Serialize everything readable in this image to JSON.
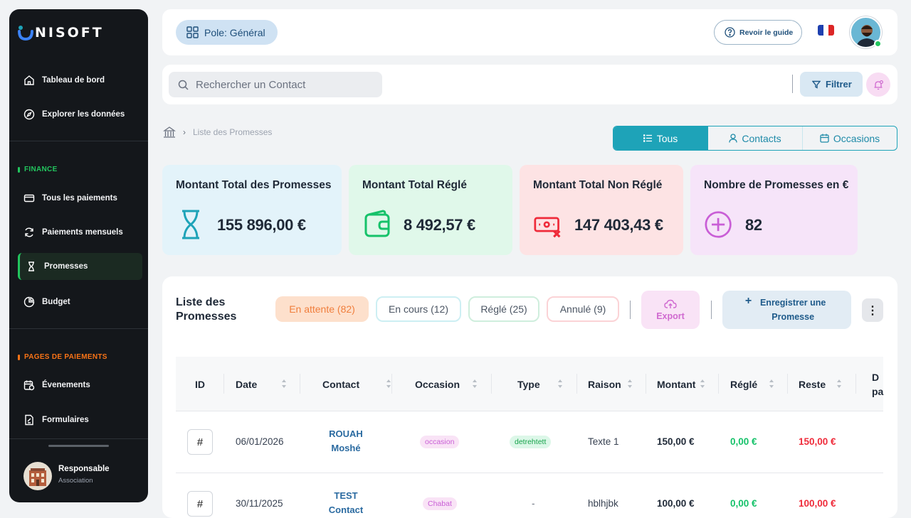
{
  "brand": {
    "name": "NISOFT"
  },
  "sidebar": {
    "items": [
      {
        "label": "Tableau de bord"
      },
      {
        "label": "Explorer les données"
      }
    ],
    "finance_label": "FINANCE",
    "finance_items": [
      {
        "label": "Tous les paiements"
      },
      {
        "label": "Paiements mensuels"
      },
      {
        "label": "Promesses"
      },
      {
        "label": "Budget"
      }
    ],
    "pages_label": "PAGES DE PAIEMENTS",
    "pages_items": [
      {
        "label": "Évenements"
      },
      {
        "label": "Formulaires"
      }
    ],
    "user": {
      "name": "Responsable",
      "role": "Association"
    }
  },
  "header": {
    "pole": "Pole: Général",
    "guide": "Revoir le guide"
  },
  "search": {
    "placeholder": "Rechercher un Contact",
    "filter": "Filtrer"
  },
  "breadcrumb": {
    "current": "Liste des Promesses"
  },
  "view_toggle": {
    "all": "Tous",
    "contacts": "Contacts",
    "occasions": "Occasions"
  },
  "cards": [
    {
      "title": "Montant Total des Promesses",
      "value": "155 896,00 €",
      "color": "#e3f3fa"
    },
    {
      "title": "Montant Total Réglé",
      "value": "8 492,57 €",
      "color": "#e0f8ea"
    },
    {
      "title": "Montant Total Non Réglé",
      "value": "147 403,43 €",
      "color": "#fde3e4"
    },
    {
      "title": "Nombre de Promesses en €",
      "value": "82",
      "color": "#f6e4f9"
    }
  ],
  "panel": {
    "title": "Liste des Promesses",
    "pending": "En attente (82)",
    "in_progress": "En cours (12)",
    "settled": "Réglé (25)",
    "cancelled": "Annulé (9)",
    "export": "Export",
    "add": "Enregistrer une Promesse"
  },
  "table": {
    "headers": [
      "ID",
      "Date",
      "Contact",
      "Occasion",
      "Type",
      "Raison",
      "Montant",
      "Réglé",
      "Reste",
      "D pa"
    ],
    "rows": [
      {
        "id": "#",
        "date": "06/01/2026",
        "contact": "ROUAH Moshé",
        "occasion": "occasion",
        "type": "detrehtett",
        "raison": "Texte 1",
        "montant": "150,00 €",
        "regle": "0,00 €",
        "reste": "150,00 €"
      },
      {
        "id": "#",
        "date": "30/11/2025",
        "contact": "TEST Contact",
        "occasion": "Chabat",
        "type": "-",
        "raison": "hblhjbk",
        "montant": "100,00 €",
        "regle": "0,00 €",
        "reste": "100,00 €"
      }
    ]
  }
}
